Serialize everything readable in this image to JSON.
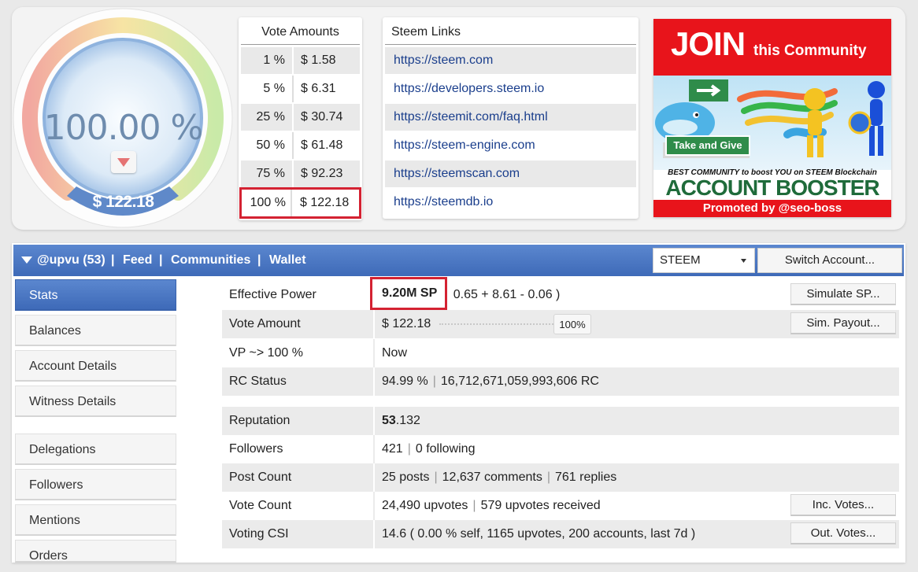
{
  "gauge": {
    "percent": "100.00 %",
    "value": "$ 122.18",
    "level": 1.0
  },
  "vote_amounts": {
    "title": "Vote Amounts",
    "rows": [
      {
        "pct": "1 %",
        "amount": "$ 1.58"
      },
      {
        "pct": "5 %",
        "amount": "$ 6.31"
      },
      {
        "pct": "25 %",
        "amount": "$ 30.74"
      },
      {
        "pct": "50 %",
        "amount": "$ 61.48"
      },
      {
        "pct": "75 %",
        "amount": "$ 92.23"
      },
      {
        "pct": "100 %",
        "amount": "$ 122.18"
      }
    ]
  },
  "steem_links": {
    "title": "Steem Links",
    "links": [
      "https://steem.com",
      "https://developers.steem.io",
      "https://steemit.com/faq.html",
      "https://steem-engine.com",
      "https://steemscan.com",
      "https://steemdb.io"
    ]
  },
  "banner": {
    "join": "JOIN",
    "community": "this Community",
    "sign": "Take and Give",
    "tagline": "BEST COMMUNITY to boost YOU on STEEM Blockchain",
    "brand": "ACCOUNT BOOSTER",
    "promoted": "Promoted by @seo-boss"
  },
  "navbar": {
    "account": "@upvu (53)",
    "sep": "|",
    "feed": "Feed",
    "communities": "Communities",
    "wallet": "Wallet",
    "chain": "STEEM",
    "switch": "Switch Account..."
  },
  "sidebar": {
    "stats": "Stats",
    "balances": "Balances",
    "account_details": "Account Details",
    "witness_details": "Witness Details",
    "delegations": "Delegations",
    "followers": "Followers",
    "mentions": "Mentions",
    "orders": "Orders"
  },
  "stats": {
    "effective_power": {
      "label": "Effective Power",
      "sp": "9.20M SP",
      "detail": "0.65 + 8.61 - 0.06 )",
      "button": "Simulate SP..."
    },
    "vote_amount": {
      "label": "Vote Amount",
      "value": "$ 122.18",
      "slider": "100%",
      "slider_level": 1.0,
      "button": "Sim. Payout..."
    },
    "vp": {
      "label": "VP ~> 100 %",
      "value": "Now"
    },
    "rc": {
      "label": "RC Status",
      "pct": "94.99 %",
      "rc": "16,712,671,059,993,606 RC"
    },
    "reputation": {
      "label": "Reputation",
      "major": "53",
      "minor": ".132"
    },
    "followers": {
      "label": "Followers",
      "count": "421",
      "following": "0 following"
    },
    "post_count": {
      "label": "Post Count",
      "posts": "25 posts",
      "comments": "12,637 comments",
      "replies": "761 replies"
    },
    "vote_count": {
      "label": "Vote Count",
      "upvotes": "24,490 upvotes",
      "received": "579 upvotes received",
      "button": "Inc. Votes..."
    },
    "csi": {
      "label": "Voting CSI",
      "value": "14.6 ( 0.00 % self, 1165 upvotes, 200 accounts, last 7d )",
      "button": "Out. Votes..."
    }
  },
  "colors": {
    "nav_blue": "#3e6ab8",
    "highlight_red": "#d42232",
    "link_blue": "#1a3e8c",
    "banner_red": "#e8141b"
  }
}
